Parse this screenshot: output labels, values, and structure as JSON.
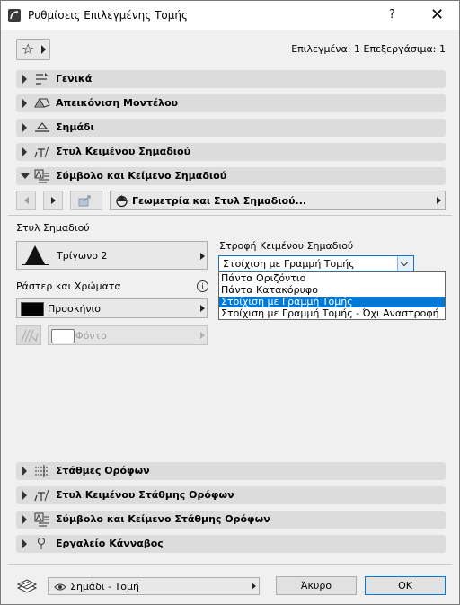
{
  "window": {
    "title": "Ρυθμίσεις Επιλεγμένης Τομής",
    "help": "?",
    "close": "✕"
  },
  "toolbar": {
    "favorites_icon": "star-icon",
    "selection_info": "Επιλεγμένα: 1 Επεξεργάσιμα: 1"
  },
  "sections_top": [
    {
      "label": "Γενικά",
      "icon": "general-icon"
    },
    {
      "label": "Απεικόνιση Μοντέλου",
      "icon": "model-display-icon"
    },
    {
      "label": "Σημάδι",
      "icon": "marker-icon"
    },
    {
      "label": "Στυλ Κειμένου Σημαδιού",
      "icon": "text-style-icon"
    },
    {
      "label": "Σύμβολο και Κείμενο Σημαδιού",
      "icon": "symbol-text-icon"
    }
  ],
  "panel": {
    "selector_label": "Γεωμετρία και Στυλ Σημαδιού...",
    "marker_style_label": "Στυλ Σημαδιού",
    "marker_value": "Τρίγωνο 2",
    "raster_label": "Ράστερ και Χρώματα",
    "pen_label": "Προσκήνιο",
    "background_label": "Φόντο",
    "text_rotation_label": "Στροφή Κειμένου Σημαδιού",
    "text_rotation_value": "Στοίχιση με Γραμμή Τομής",
    "options": [
      "Πάντα Οριζόντιο",
      "Πάντα Κατακόρυφο",
      "Στοίχιση με Γραμμή Τομής",
      "Στοίχιση με Γραμμή Τομής - Όχι Αναστροφή"
    ],
    "selected_option_index": 2
  },
  "sections_bottom": [
    {
      "label": "Στάθμες Ορόφων",
      "icon": "story-levels-icon"
    },
    {
      "label": "Στυλ Κειμένου Στάθμης Ορόφων",
      "icon": "text-style-icon"
    },
    {
      "label": "Σύμβολο και Κείμενο Στάθμης Ορόφων",
      "icon": "symbol-text-icon"
    },
    {
      "label": "Εργαλείο Κάνναβος",
      "icon": "grid-tool-icon"
    }
  ],
  "footer": {
    "layer_value": "Σημάδι - Τομή",
    "cancel_label": "Άκυρο",
    "ok_label": "OK"
  },
  "colors": {
    "accent": "#0078d7",
    "section_bg": "#dcdcdc",
    "window_bg": "#f0f0f0"
  }
}
